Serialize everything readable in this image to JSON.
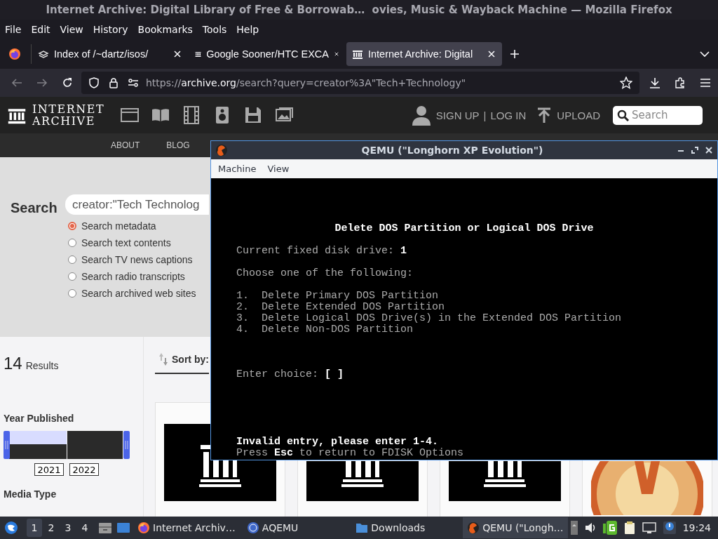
{
  "firefox": {
    "title": "Internet Archive: Digital Library of Free & Borrowab…  ovies, Music & Wayback Machine — Mozilla Firefox",
    "menu": [
      "File",
      "Edit",
      "View",
      "History",
      "Bookmarks",
      "Tools",
      "Help"
    ],
    "tabs": [
      {
        "label": "Index of /~dartz/isos/",
        "kind": "stack",
        "selected": false
      },
      {
        "label": "Google Sooner/HTC EXCA",
        "kind": "temple",
        "selected": false
      },
      {
        "label": "Internet Archive: Digital",
        "kind": "temple",
        "selected": true
      }
    ],
    "nav": {
      "back_disabled": true,
      "forward_disabled": true
    },
    "url": {
      "scheme": "https://",
      "host": "archive.org",
      "path": "/search?query=creator%3A\"Tech+Technology\""
    }
  },
  "archive": {
    "logo": [
      "INTERNET",
      "ARCHIVE"
    ],
    "account": {
      "sign_up": "SIGN UP",
      "separator": "|",
      "log_in": "LOG IN"
    },
    "upload": "UPLOAD",
    "search_placeholder": "Search",
    "nav": [
      "ABOUT",
      "BLOG"
    ],
    "search": {
      "label": "Search",
      "value": "creator:\"Tech Technolog",
      "options": [
        {
          "label": "Search metadata",
          "selected": true
        },
        {
          "label": "Search text contents",
          "selected": false
        },
        {
          "label": "Search TV news captions",
          "selected": false
        },
        {
          "label": "Search radio transcripts",
          "selected": false
        },
        {
          "label": "Search archived web sites",
          "selected": false
        }
      ]
    },
    "results": {
      "count": "14",
      "label": "Results",
      "sort_label": "Sort by:"
    },
    "facets": {
      "year_title": "Year Published",
      "year_from": "2021",
      "year_to": "2022",
      "media_title": "Media Type"
    },
    "cards": [
      {
        "kind": "picture"
      },
      {
        "kind": "picture"
      },
      {
        "kind": "picture"
      },
      {
        "kind": "picture"
      }
    ]
  },
  "qemu": {
    "title": "QEMU (\"Longhorn XP Evolution\")",
    "menu": [
      "Machine",
      "View"
    ],
    "screen": {
      "heading": "Delete DOS Partition or Logical DOS Drive",
      "drive": "Current fixed disk drive: **1**",
      "prompt": "Choose one of the following:",
      "options": [
        "1.  Delete Primary DOS Partition",
        "2.  Delete Extended DOS Partition",
        "3.  Delete Logical DOS Drive(s) in the Extended DOS Partition",
        "4.  Delete Non-DOS Partition"
      ],
      "choice": "Enter choice: **[ ]**",
      "error": "Invalid entry, please enter 1-4.",
      "hint": "Press **Esc** to return to FDISK Options"
    }
  },
  "taskbar": {
    "workspaces": [
      {
        "label": "1",
        "selected": true
      },
      {
        "label": "2",
        "selected": false
      },
      {
        "label": "3",
        "selected": false
      },
      {
        "label": "4",
        "selected": false
      }
    ],
    "tasks": [
      {
        "label": "Internet Archiv…",
        "kind": "browser",
        "selected": false
      },
      {
        "label": "AQEMU",
        "kind": "emulator",
        "selected": false
      },
      {
        "label": "Downloads",
        "kind": "folder",
        "selected": false
      },
      {
        "label": "QEMU (\"Longh…",
        "kind": "qemu",
        "selected": true
      }
    ],
    "clock": "19:24"
  }
}
